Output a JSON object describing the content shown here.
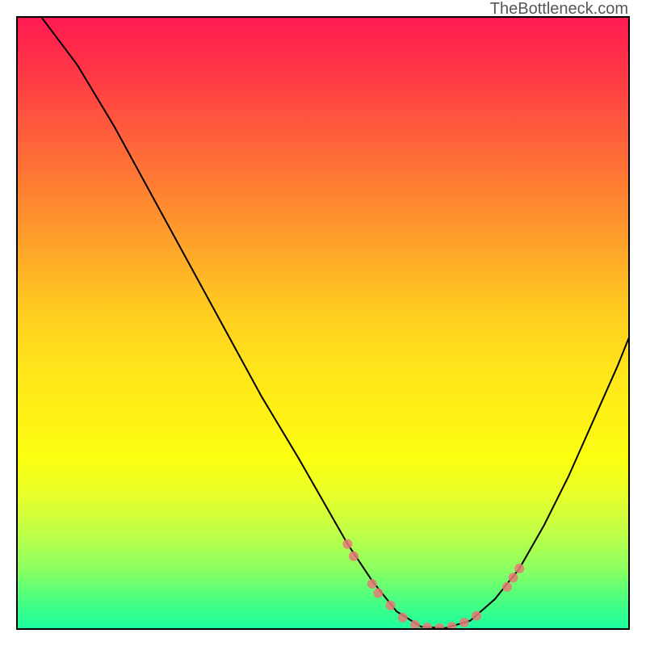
{
  "attribution": "TheBottleneck.com",
  "chart_data": {
    "type": "line",
    "title": "",
    "xlabel": "",
    "ylabel": "",
    "xlim": [
      0,
      100
    ],
    "ylim": [
      0,
      100
    ],
    "background": "vertical-gradient red→green (bottleneck severity)",
    "curve_description": "V-shaped bottleneck curve; minimum near x≈68 at y≈0",
    "curve_points": [
      {
        "x": 4,
        "y": 100
      },
      {
        "x": 10,
        "y": 92
      },
      {
        "x": 16,
        "y": 82
      },
      {
        "x": 22,
        "y": 71
      },
      {
        "x": 28,
        "y": 60
      },
      {
        "x": 34,
        "y": 49
      },
      {
        "x": 40,
        "y": 38
      },
      {
        "x": 46,
        "y": 28
      },
      {
        "x": 50,
        "y": 21
      },
      {
        "x": 54,
        "y": 14
      },
      {
        "x": 58,
        "y": 8
      },
      {
        "x": 62,
        "y": 3
      },
      {
        "x": 66,
        "y": 0.5
      },
      {
        "x": 70,
        "y": 0.3
      },
      {
        "x": 74,
        "y": 1.5
      },
      {
        "x": 78,
        "y": 5
      },
      {
        "x": 82,
        "y": 10
      },
      {
        "x": 86,
        "y": 17
      },
      {
        "x": 90,
        "y": 25
      },
      {
        "x": 94,
        "y": 34
      },
      {
        "x": 98,
        "y": 43
      },
      {
        "x": 100,
        "y": 48
      }
    ],
    "markers": [
      {
        "x": 54,
        "y": 14,
        "r": 6
      },
      {
        "x": 55,
        "y": 12,
        "r": 6
      },
      {
        "x": 58,
        "y": 7.5,
        "r": 6
      },
      {
        "x": 59,
        "y": 6,
        "r": 6
      },
      {
        "x": 61,
        "y": 4,
        "r": 6
      },
      {
        "x": 63,
        "y": 2,
        "r": 6
      },
      {
        "x": 65,
        "y": 0.8,
        "r": 6
      },
      {
        "x": 67,
        "y": 0.4,
        "r": 6
      },
      {
        "x": 69,
        "y": 0.3,
        "r": 6
      },
      {
        "x": 71,
        "y": 0.5,
        "r": 6
      },
      {
        "x": 73,
        "y": 1.2,
        "r": 6
      },
      {
        "x": 75,
        "y": 2.3,
        "r": 6
      },
      {
        "x": 80,
        "y": 7,
        "r": 6
      },
      {
        "x": 81,
        "y": 8.5,
        "r": 6
      },
      {
        "x": 82,
        "y": 10,
        "r": 6
      }
    ]
  }
}
